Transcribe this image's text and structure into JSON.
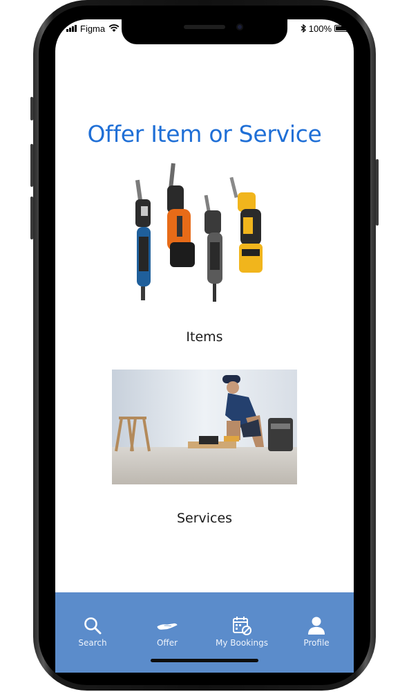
{
  "status_bar": {
    "carrier": "Figma",
    "battery_percent": "100%"
  },
  "page": {
    "title": "Offer Item or Service"
  },
  "options": [
    {
      "label": "Items"
    },
    {
      "label": "Services"
    }
  ],
  "bottom_nav": {
    "items": [
      {
        "label": "Search",
        "icon": "search-icon"
      },
      {
        "label": "Offer",
        "icon": "offer-hand-icon"
      },
      {
        "label": "My Bookings",
        "icon": "calendar-icon"
      },
      {
        "label": "Profile",
        "icon": "profile-icon"
      }
    ]
  },
  "colors": {
    "title": "#1f6fd6",
    "nav_background": "#5b8ccb"
  }
}
